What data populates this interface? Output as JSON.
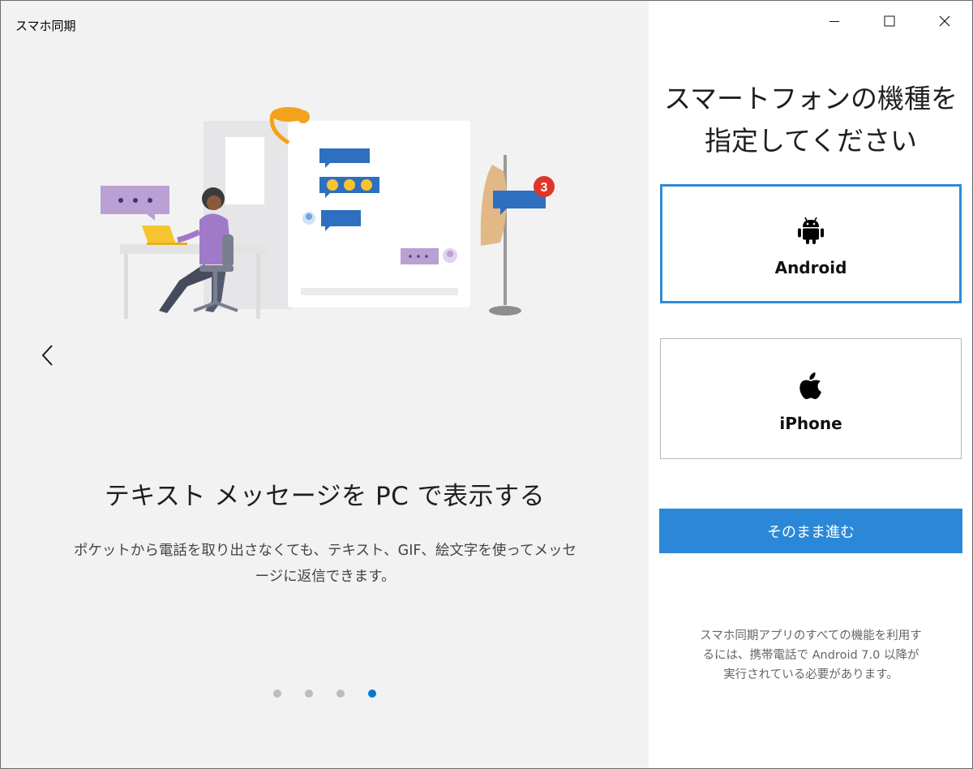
{
  "window": {
    "title": "スマホ同期"
  },
  "slide": {
    "title": "テキスト メッセージを PC で表示する",
    "description": "ポケットから電話を取り出さなくても、テキスト、GIF、絵文字を使ってメッセージに返信できます。",
    "notification_count": "3",
    "total": 4,
    "current": 4
  },
  "setup": {
    "heading": "スマートフォンの機種を指定してください",
    "options": [
      {
        "label": "Android",
        "icon": "android-icon",
        "selected": true
      },
      {
        "label": "iPhone",
        "icon": "apple-icon",
        "selected": false
      }
    ],
    "continue_label": "そのまま進む",
    "requirement_note": "スマホ同期アプリのすべての機能を利用するには、携帯電話で Android 7.0 以降が実行されている必要があります。"
  },
  "colors": {
    "accent": "#2b88d8",
    "selected_border": "#2e8bd8",
    "active_dot": "#0078d4",
    "left_pane_bg": "#f2f2f2"
  }
}
